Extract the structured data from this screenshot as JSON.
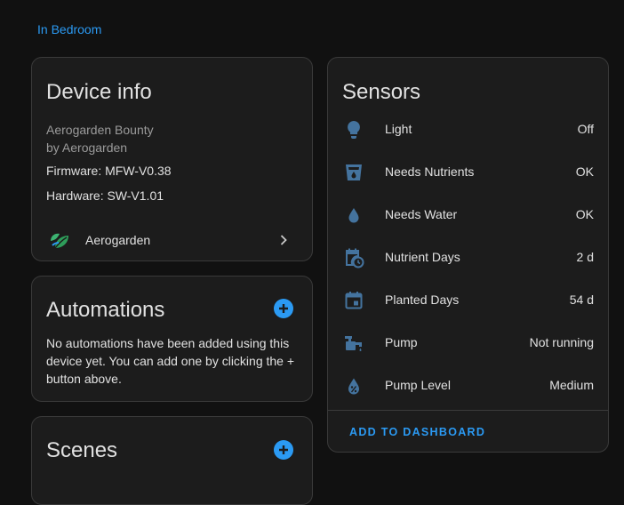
{
  "area": {
    "label": "In Bedroom"
  },
  "device_info": {
    "title": "Device info",
    "model": "Aerogarden Bounty",
    "manufacturer": "by Aerogarden",
    "firmware": "Firmware: MFW-V0.38",
    "hardware": "Hardware: SW-V1.01",
    "integration": {
      "label": "Aerogarden",
      "icon": "aerogarden-leaf-icon"
    }
  },
  "automations": {
    "title": "Automations",
    "empty_text": "No automations have been added using this device yet. You can add one by clicking the + button above."
  },
  "scenes": {
    "title": "Scenes"
  },
  "sensors": {
    "title": "Sensors",
    "items": [
      {
        "name": "Light",
        "state": "Off",
        "icon": "lightbulb-icon"
      },
      {
        "name": "Needs Nutrients",
        "state": "OK",
        "icon": "cup-water-icon"
      },
      {
        "name": "Needs Water",
        "state": "OK",
        "icon": "water-drop-icon"
      },
      {
        "name": "Nutrient Days",
        "state": "2 d",
        "icon": "calendar-clock-icon"
      },
      {
        "name": "Planted Days",
        "state": "54 d",
        "icon": "calendar-icon"
      },
      {
        "name": "Pump",
        "state": "Not running",
        "icon": "water-pump-icon"
      },
      {
        "name": "Pump Level",
        "state": "Medium",
        "icon": "water-percent-icon"
      }
    ],
    "add_to_dashboard": "ADD TO DASHBOARD"
  },
  "colors": {
    "accent": "#2b9af3",
    "icon": "#44739e",
    "card_bg": "#1c1c1c",
    "page_bg": "#111111"
  }
}
